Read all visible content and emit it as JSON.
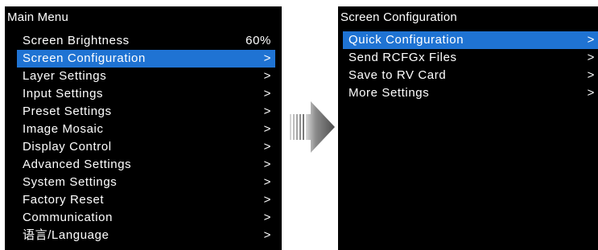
{
  "main_menu": {
    "title": "Main Menu",
    "items": [
      {
        "label": "Screen Brightness",
        "value": "60%"
      },
      {
        "label": "Screen Configuration",
        "value": ">",
        "selected": true
      },
      {
        "label": "Layer Settings",
        "value": ">"
      },
      {
        "label": "Input Settings",
        "value": ">"
      },
      {
        "label": "Preset Settings",
        "value": ">"
      },
      {
        "label": "Image Mosaic",
        "value": ">"
      },
      {
        "label": "Display Control",
        "value": ">"
      },
      {
        "label": "Advanced Settings",
        "value": ">"
      },
      {
        "label": "System Settings",
        "value": ">"
      },
      {
        "label": "Factory Reset",
        "value": ">"
      },
      {
        "label": "Communication",
        "value": ">"
      },
      {
        "label": "语言/Language",
        "value": ">"
      }
    ]
  },
  "screen_configuration": {
    "title": "Screen Configuration",
    "items": [
      {
        "label": "Quick Configuration",
        "value": ">",
        "selected": true
      },
      {
        "label": "Send RCFGx Files",
        "value": ">"
      },
      {
        "label": "Save to RV Card",
        "value": ">"
      },
      {
        "label": "More Settings",
        "value": ">"
      }
    ]
  },
  "colors": {
    "panel_background": "#000000",
    "text": "#ffffff",
    "selection": "#1f73d3",
    "arrow": "#5a5a5a"
  },
  "icons": {
    "transition_arrow": "right-arrow-icon"
  }
}
